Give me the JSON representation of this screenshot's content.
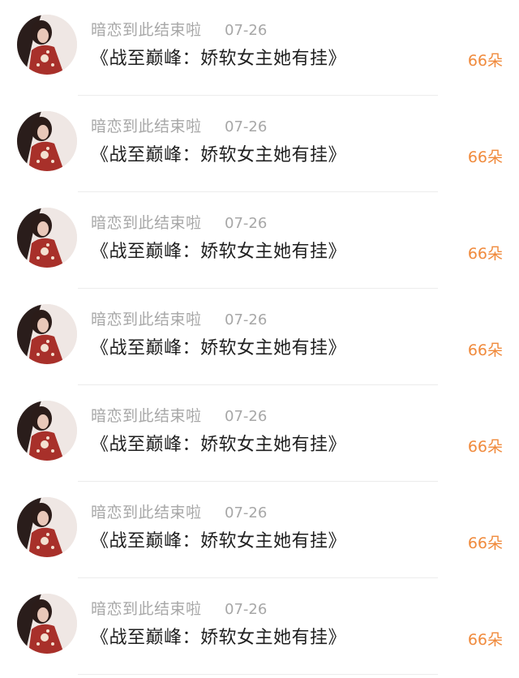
{
  "accent_color": "#f08a3c",
  "avatar_icon": "avatar-icon",
  "rows": [
    {
      "username": "暗恋到此结束啦",
      "date": "07-26",
      "title": "《战至巅峰：娇软女主她有挂》",
      "count": "66朵"
    },
    {
      "username": "暗恋到此结束啦",
      "date": "07-26",
      "title": "《战至巅峰：娇软女主她有挂》",
      "count": "66朵"
    },
    {
      "username": "暗恋到此结束啦",
      "date": "07-26",
      "title": "《战至巅峰：娇软女主她有挂》",
      "count": "66朵"
    },
    {
      "username": "暗恋到此结束啦",
      "date": "07-26",
      "title": "《战至巅峰：娇软女主她有挂》",
      "count": "66朵"
    },
    {
      "username": "暗恋到此结束啦",
      "date": "07-26",
      "title": "《战至巅峰：娇软女主她有挂》",
      "count": "66朵"
    },
    {
      "username": "暗恋到此结束啦",
      "date": "07-26",
      "title": "《战至巅峰：娇软女主她有挂》",
      "count": "66朵"
    },
    {
      "username": "暗恋到此结束啦",
      "date": "07-26",
      "title": "《战至巅峰：娇软女主她有挂》",
      "count": "66朵"
    }
  ]
}
